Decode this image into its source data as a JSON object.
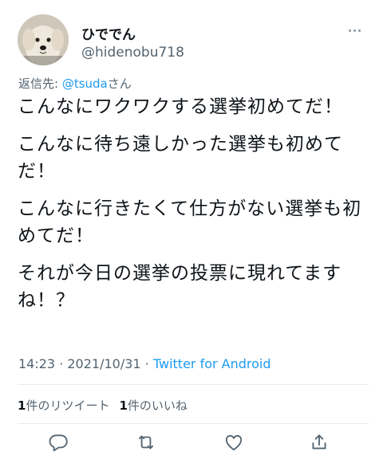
{
  "user": {
    "display_name": "ひででん",
    "handle": "@hidenobu718",
    "avatar_icon": "dog-avatar"
  },
  "reply": {
    "prefix": "返信先: ",
    "mention": "@tsuda",
    "suffix": "さん"
  },
  "tweet": {
    "paragraphs": [
      "こんなにワクワクする選挙初めてだ！",
      "こんなに待ち遠しかった選挙も初めてだ！",
      "こんなに行きたくて仕方がない選挙も初めてだ！",
      "それが今日の選挙の投票に現れてますね！？"
    ]
  },
  "meta": {
    "time": "14:23",
    "separator1": " · ",
    "date": "2021/10/31",
    "separator2": " · ",
    "source": "Twitter for Android"
  },
  "stats": {
    "retweet_count": "1",
    "retweet_label": "件のリツイート",
    "like_count": "1",
    "like_label": "件のいいね"
  },
  "actions": {
    "reply_icon": "reply-icon",
    "retweet_icon": "retweet-icon",
    "like_icon": "heart-icon",
    "share_icon": "share-icon"
  },
  "colors": {
    "link": "#1d9bf0",
    "text": "#0f1419",
    "secondary": "#536471",
    "divider": "#e6ecf0"
  }
}
